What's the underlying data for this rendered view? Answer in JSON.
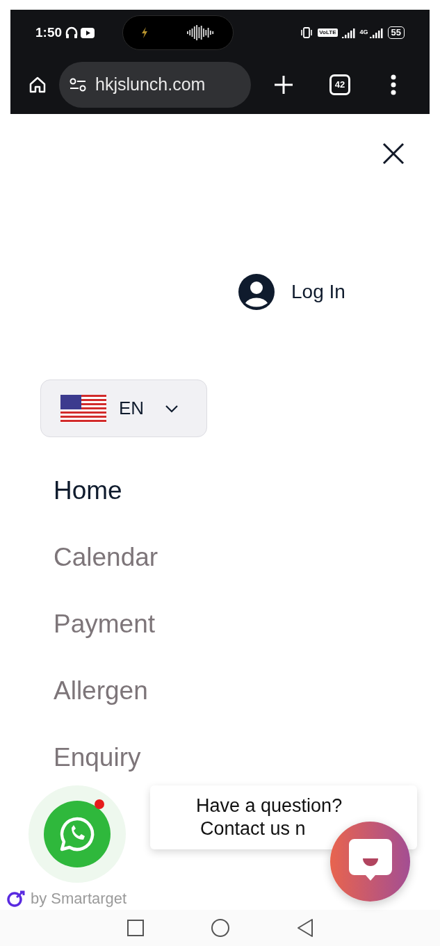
{
  "status_bar": {
    "time": "1:50",
    "volte": "VoLTE",
    "network": "4G",
    "battery": "55"
  },
  "browser": {
    "url": "hkjslunch.com",
    "tab_count": "42"
  },
  "account": {
    "label": "Log In"
  },
  "language": {
    "code": "EN"
  },
  "menu": [
    {
      "label": "Home",
      "selected": true
    },
    {
      "label": "Calendar",
      "selected": false
    },
    {
      "label": "Payment",
      "selected": false
    },
    {
      "label": "Allergen",
      "selected": false
    },
    {
      "label": "Enquiry",
      "selected": false
    }
  ],
  "chat_widget": {
    "prompt_lines": [
      "Have a question?",
      "Contact us n"
    ],
    "branding": "by Smartarget"
  }
}
